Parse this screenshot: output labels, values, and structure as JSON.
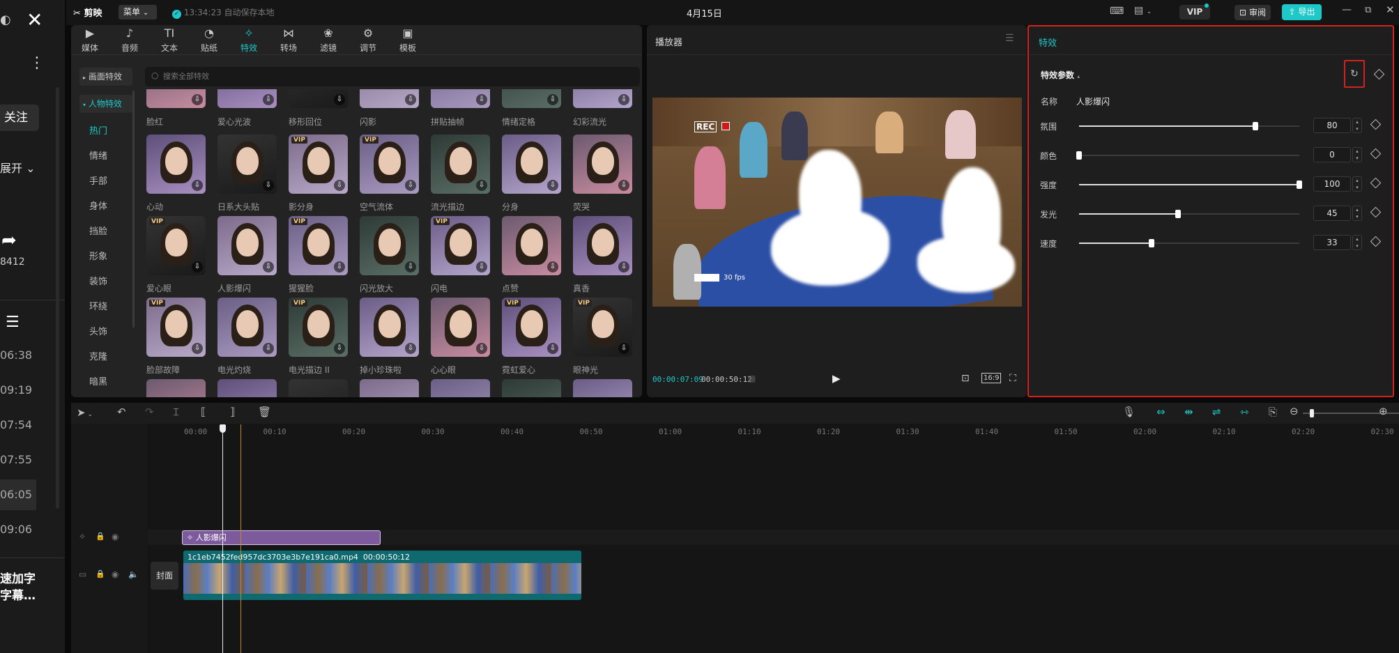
{
  "left_panel": {
    "follow": "关注",
    "expand": "展开",
    "share_count": "8412",
    "times": [
      "06:38",
      "09:19",
      "07:54",
      "07:55",
      "06:05",
      "09:06"
    ],
    "bottom_text_1": "速加字",
    "bottom_text_2": "字幕…"
  },
  "topbar": {
    "app_name": "剪映",
    "menu": "菜单",
    "autosave": "13:34:23 自动保存本地",
    "date": "4月15日",
    "vip": "VIP",
    "review": "审阅",
    "export": "导出"
  },
  "toolbar": [
    {
      "label": "媒体",
      "icon": "▶",
      "name": "media"
    },
    {
      "label": "音频",
      "icon": "♪",
      "name": "audio"
    },
    {
      "label": "文本",
      "icon": "TI",
      "name": "text"
    },
    {
      "label": "贴纸",
      "icon": "◔",
      "name": "sticker"
    },
    {
      "label": "特效",
      "icon": "✧",
      "name": "effects"
    },
    {
      "label": "转场",
      "icon": "⋈",
      "name": "transition"
    },
    {
      "label": "滤镜",
      "icon": "❀",
      "name": "filter"
    },
    {
      "label": "调节",
      "icon": "⚙",
      "name": "adjust"
    },
    {
      "label": "模板",
      "icon": "▣",
      "name": "template"
    }
  ],
  "effects_sidebar": {
    "screen_effects": "画面特效",
    "person_effects": "人物特效",
    "categories": [
      "热门",
      "情绪",
      "手部",
      "身体",
      "挡脸",
      "形象",
      "装饰",
      "环绕",
      "头饰",
      "克隆",
      "暗黑"
    ]
  },
  "search": {
    "placeholder": "搜索全部特效"
  },
  "effects_grid": [
    [
      "脸红",
      "爱心光波",
      "移形回位",
      "闪影",
      "拼贴抽帧",
      "情绪定格",
      "幻彩流光"
    ],
    [
      "心动",
      "日系大头贴",
      "影分身",
      "空气流体",
      "流光描边",
      "分身",
      "荧哭"
    ],
    [
      "爱心眼",
      "人影爆闪",
      "猩猩脸",
      "闪光放大",
      "闪电",
      "点赞",
      "真香"
    ],
    [
      "脸部故障",
      "电光灼烧",
      "电光描边 II",
      "掉小珍珠啦",
      "心心眼",
      "霓虹爱心",
      "眼神光"
    ]
  ],
  "player": {
    "title": "播放器",
    "time_current": "00:00:07:09",
    "time_total": "00:00:50:12",
    "rec": "REC",
    "fps": "30 fps",
    "ratio": "16:9"
  },
  "effect_params": {
    "panel_title": "特效",
    "section": "特效参数",
    "name_label": "名称",
    "name_value": "人影爆闪",
    "params": [
      {
        "label": "氛围",
        "value": 80
      },
      {
        "label": "颜色",
        "value": 0
      },
      {
        "label": "强度",
        "value": 100
      },
      {
        "label": "发光",
        "value": 45
      },
      {
        "label": "速度",
        "value": 33
      }
    ]
  },
  "timeline": {
    "ruler": [
      "00:00",
      "00:10",
      "00:20",
      "00:30",
      "00:40",
      "00:50",
      "01:00",
      "01:10",
      "01:20",
      "01:30",
      "01:40",
      "01:50",
      "02:00",
      "02:10",
      "02:20",
      "02:30"
    ],
    "effect_clip": "人影爆闪",
    "video_clip_name": "1c1eb7452fed957dc3703e3b7e191ca0.mp4",
    "video_clip_duration": "00:00:50:12",
    "cover": "封面"
  }
}
